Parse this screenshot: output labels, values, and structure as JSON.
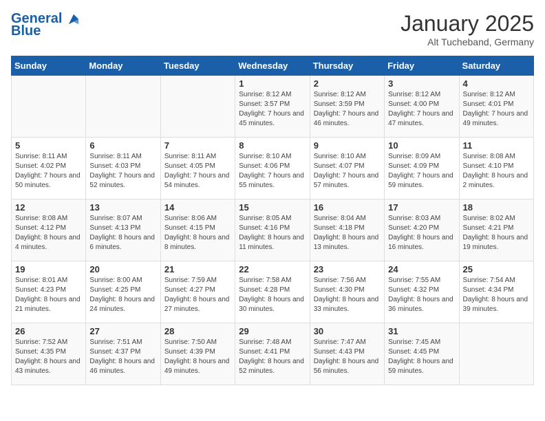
{
  "header": {
    "logo_line1": "General",
    "logo_line2": "Blue",
    "title": "January 2025",
    "subtitle": "Alt Tucheband, Germany"
  },
  "weekdays": [
    "Sunday",
    "Monday",
    "Tuesday",
    "Wednesday",
    "Thursday",
    "Friday",
    "Saturday"
  ],
  "weeks": [
    [
      {
        "day": "",
        "info": ""
      },
      {
        "day": "",
        "info": ""
      },
      {
        "day": "",
        "info": ""
      },
      {
        "day": "1",
        "info": "Sunrise: 8:12 AM\nSunset: 3:57 PM\nDaylight: 7 hours and 45 minutes."
      },
      {
        "day": "2",
        "info": "Sunrise: 8:12 AM\nSunset: 3:59 PM\nDaylight: 7 hours and 46 minutes."
      },
      {
        "day": "3",
        "info": "Sunrise: 8:12 AM\nSunset: 4:00 PM\nDaylight: 7 hours and 47 minutes."
      },
      {
        "day": "4",
        "info": "Sunrise: 8:12 AM\nSunset: 4:01 PM\nDaylight: 7 hours and 49 minutes."
      }
    ],
    [
      {
        "day": "5",
        "info": "Sunrise: 8:11 AM\nSunset: 4:02 PM\nDaylight: 7 hours and 50 minutes."
      },
      {
        "day": "6",
        "info": "Sunrise: 8:11 AM\nSunset: 4:03 PM\nDaylight: 7 hours and 52 minutes."
      },
      {
        "day": "7",
        "info": "Sunrise: 8:11 AM\nSunset: 4:05 PM\nDaylight: 7 hours and 54 minutes."
      },
      {
        "day": "8",
        "info": "Sunrise: 8:10 AM\nSunset: 4:06 PM\nDaylight: 7 hours and 55 minutes."
      },
      {
        "day": "9",
        "info": "Sunrise: 8:10 AM\nSunset: 4:07 PM\nDaylight: 7 hours and 57 minutes."
      },
      {
        "day": "10",
        "info": "Sunrise: 8:09 AM\nSunset: 4:09 PM\nDaylight: 7 hours and 59 minutes."
      },
      {
        "day": "11",
        "info": "Sunrise: 8:08 AM\nSunset: 4:10 PM\nDaylight: 8 hours and 2 minutes."
      }
    ],
    [
      {
        "day": "12",
        "info": "Sunrise: 8:08 AM\nSunset: 4:12 PM\nDaylight: 8 hours and 4 minutes."
      },
      {
        "day": "13",
        "info": "Sunrise: 8:07 AM\nSunset: 4:13 PM\nDaylight: 8 hours and 6 minutes."
      },
      {
        "day": "14",
        "info": "Sunrise: 8:06 AM\nSunset: 4:15 PM\nDaylight: 8 hours and 8 minutes."
      },
      {
        "day": "15",
        "info": "Sunrise: 8:05 AM\nSunset: 4:16 PM\nDaylight: 8 hours and 11 minutes."
      },
      {
        "day": "16",
        "info": "Sunrise: 8:04 AM\nSunset: 4:18 PM\nDaylight: 8 hours and 13 minutes."
      },
      {
        "day": "17",
        "info": "Sunrise: 8:03 AM\nSunset: 4:20 PM\nDaylight: 8 hours and 16 minutes."
      },
      {
        "day": "18",
        "info": "Sunrise: 8:02 AM\nSunset: 4:21 PM\nDaylight: 8 hours and 19 minutes."
      }
    ],
    [
      {
        "day": "19",
        "info": "Sunrise: 8:01 AM\nSunset: 4:23 PM\nDaylight: 8 hours and 21 minutes."
      },
      {
        "day": "20",
        "info": "Sunrise: 8:00 AM\nSunset: 4:25 PM\nDaylight: 8 hours and 24 minutes."
      },
      {
        "day": "21",
        "info": "Sunrise: 7:59 AM\nSunset: 4:27 PM\nDaylight: 8 hours and 27 minutes."
      },
      {
        "day": "22",
        "info": "Sunrise: 7:58 AM\nSunset: 4:28 PM\nDaylight: 8 hours and 30 minutes."
      },
      {
        "day": "23",
        "info": "Sunrise: 7:56 AM\nSunset: 4:30 PM\nDaylight: 8 hours and 33 minutes."
      },
      {
        "day": "24",
        "info": "Sunrise: 7:55 AM\nSunset: 4:32 PM\nDaylight: 8 hours and 36 minutes."
      },
      {
        "day": "25",
        "info": "Sunrise: 7:54 AM\nSunset: 4:34 PM\nDaylight: 8 hours and 39 minutes."
      }
    ],
    [
      {
        "day": "26",
        "info": "Sunrise: 7:52 AM\nSunset: 4:35 PM\nDaylight: 8 hours and 43 minutes."
      },
      {
        "day": "27",
        "info": "Sunrise: 7:51 AM\nSunset: 4:37 PM\nDaylight: 8 hours and 46 minutes."
      },
      {
        "day": "28",
        "info": "Sunrise: 7:50 AM\nSunset: 4:39 PM\nDaylight: 8 hours and 49 minutes."
      },
      {
        "day": "29",
        "info": "Sunrise: 7:48 AM\nSunset: 4:41 PM\nDaylight: 8 hours and 52 minutes."
      },
      {
        "day": "30",
        "info": "Sunrise: 7:47 AM\nSunset: 4:43 PM\nDaylight: 8 hours and 56 minutes."
      },
      {
        "day": "31",
        "info": "Sunrise: 7:45 AM\nSunset: 4:45 PM\nDaylight: 8 hours and 59 minutes."
      },
      {
        "day": "",
        "info": ""
      }
    ]
  ]
}
